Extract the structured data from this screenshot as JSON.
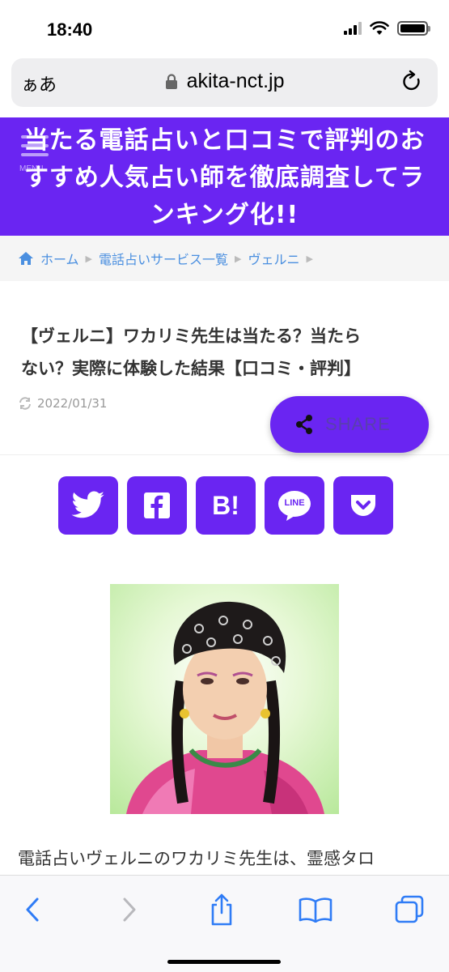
{
  "status_bar": {
    "time": "18:40"
  },
  "browser": {
    "aa_label": "ぁあ",
    "url": "akita-nct.jp"
  },
  "site": {
    "title_line1": "当たる電話占いと口コミで評判のお",
    "title_line2": "すすめ人気占い師を徹底調査してラ",
    "title_line3": "ンキング化!!",
    "menu_label": "MENU"
  },
  "breadcrumb": {
    "items": [
      "ホーム",
      "電話占いサービス一覧",
      "ヴェルニ"
    ]
  },
  "article": {
    "title_line1": "【ヴェルニ】ワカリミ先生は当たる？当たら",
    "title_line2": "ない？実際に体験した結果【口コミ・評判】",
    "date": "2022/01/31",
    "body_first_line": "電話占いヴェルニのワカリミ先生は、霊感タロ"
  },
  "share": {
    "label": "SHARE"
  },
  "social": {
    "hatena_label": "B!",
    "line_label": "LINE"
  },
  "colors": {
    "brand": "#6a25f2",
    "link": "#4a8fe0",
    "ios_blue": "#2f7cf6"
  }
}
